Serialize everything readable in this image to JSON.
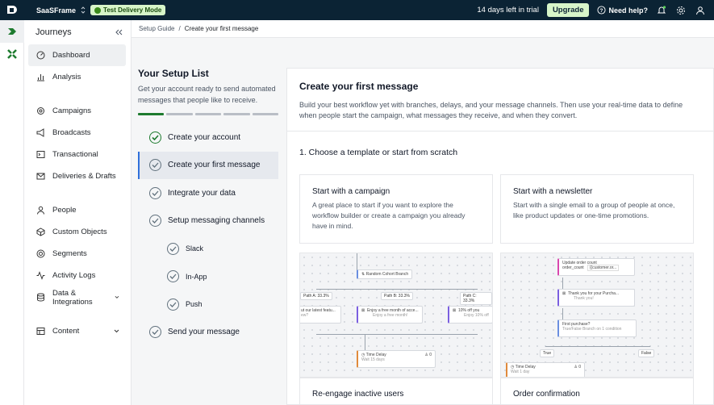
{
  "topbar": {
    "workspace": "SaaSFrame",
    "mode_badge": "Test Delivery Mode",
    "trial_text": "14 days left in trial",
    "upgrade_label": "Upgrade",
    "help_label": "Need help?"
  },
  "nav": {
    "title": "Journeys",
    "items": [
      {
        "label": "Dashboard",
        "icon": "dashboard-icon"
      },
      {
        "label": "Analysis",
        "icon": "analysis-icon"
      },
      {
        "label": "Campaigns",
        "icon": "campaigns-icon"
      },
      {
        "label": "Broadcasts",
        "icon": "broadcasts-icon"
      },
      {
        "label": "Transactional",
        "icon": "transactional-icon"
      },
      {
        "label": "Deliveries & Drafts",
        "icon": "deliveries-icon"
      },
      {
        "label": "People",
        "icon": "people-icon"
      },
      {
        "label": "Custom Objects",
        "icon": "custom-objects-icon"
      },
      {
        "label": "Segments",
        "icon": "segments-icon"
      },
      {
        "label": "Activity Logs",
        "icon": "activity-logs-icon"
      },
      {
        "label": "Data & Integrations",
        "icon": "data-integrations-icon"
      },
      {
        "label": "Content",
        "icon": "content-icon"
      }
    ]
  },
  "breadcrumb": {
    "parent": "Setup Guide",
    "separator": "/",
    "current": "Create your first message"
  },
  "setup": {
    "title": "Your Setup List",
    "description": "Get your account ready to send automated messages that people like to receive.",
    "progress_done": 1,
    "progress_total": 5,
    "steps": [
      "Create your account",
      "Create your first message",
      "Integrate your data",
      "Setup messaging channels",
      "Slack",
      "In-App",
      "Push",
      "Send your message"
    ]
  },
  "panel": {
    "title": "Create your first message",
    "description": "Build your best workflow yet with branches, delays, and your message channels. Then use your real-time data to define when people start the campaign, what messages they receive, and when they convert.",
    "step_heading": "1. Choose a template or start from scratch",
    "cards": [
      {
        "title": "Start with a campaign",
        "text": "A great place to start if you want to explore the workflow builder or create a campaign you already have in mind."
      },
      {
        "title": "Start with a newsletter",
        "text": "Start with a single email to a group of people at once, like product updates or one-time promotions."
      }
    ],
    "preview_left": {
      "branch": "Random Cohort Branch",
      "path_a": "Path A: 33.3%",
      "path_b": "Path B: 33.3%",
      "path_c": "Path C: 33.3%",
      "msg_a": "ut our latest featu...",
      "msg_a2": "ew?",
      "msg_b": "Enjoy a free month of acce...",
      "msg_b2": "Enjoy a free month!",
      "msg_c": "10% off you",
      "msg_c2": "Enjoy 10% off",
      "delay": "Time Delay",
      "delay_sub": "Wait 15 days",
      "count": "0"
    },
    "preview_right": {
      "update": "Update order count",
      "attr": "order_count",
      "attr_val": "{{customer.or...",
      "msg": "Thank you for your Purcha...",
      "msg_sub": "Thank you!",
      "cond": "First purchase?",
      "cond_sub": "True/False Branch on 1 condition",
      "true_label": "True",
      "false_label": "False",
      "delay": "Time Delay",
      "delay_sub": "Wait 1 day",
      "count": "0"
    },
    "bottom_cards": [
      "Re-engage inactive users",
      "Order confirmation"
    ]
  }
}
